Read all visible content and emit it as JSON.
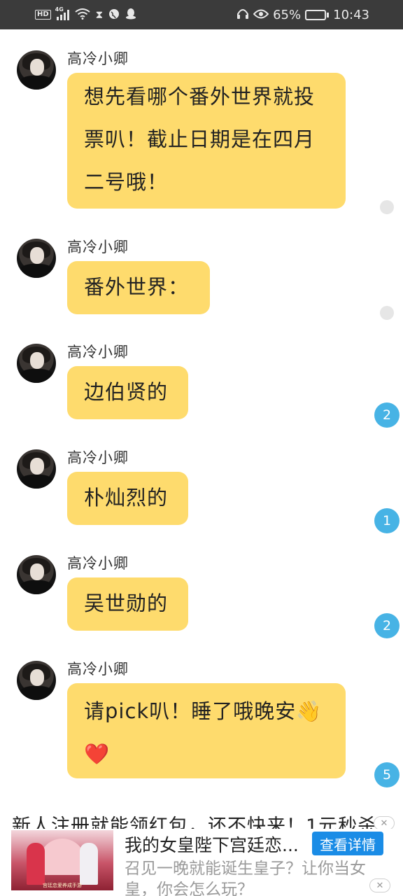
{
  "status_bar": {
    "hd": "HD",
    "network": "4G",
    "battery_pct": "65%",
    "time": "10:43",
    "battery_level": 0.65
  },
  "messages": [
    {
      "sender": "高冷小卿",
      "lines": [
        "想先看哪个番外世界就投",
        "票叭！截止日期是在四月",
        "二号哦！"
      ],
      "emoji": "",
      "badge": "",
      "read_dot": true
    },
    {
      "sender": "高冷小卿",
      "lines": [
        "番外世界："
      ],
      "emoji": "",
      "badge": "",
      "read_dot": true
    },
    {
      "sender": "高冷小卿",
      "lines": [
        "边伯贤的"
      ],
      "emoji": "",
      "badge": "2",
      "read_dot": false
    },
    {
      "sender": "高冷小卿",
      "lines": [
        "朴灿烈的"
      ],
      "emoji": "",
      "badge": "1",
      "read_dot": false
    },
    {
      "sender": "高冷小卿",
      "lines": [
        "吴世勋的"
      ],
      "emoji": "",
      "badge": "2",
      "read_dot": false
    },
    {
      "sender": "高冷小卿",
      "lines": [
        "请pick叭！睡了哦晚安👋",
        "❤️"
      ],
      "emoji": "",
      "badge": "5",
      "read_dot": false
    }
  ],
  "ad": {
    "cut_text": "新人注册就能领红包，还不快来！1元秒杀",
    "title": "我的女皇陛下宫廷恋...",
    "cta": "查看详情",
    "description": "召见一晚就能诞生皇子？让你当女皇，你会怎么玩？",
    "thumb_caption": "宫廷恋爱养成手游",
    "close_icon": "close-icon"
  },
  "colors": {
    "bubble": "#fedb6d",
    "badge": "#47b3e5",
    "status_bar": "#3b3b3b",
    "cta": "#1a8ce6"
  }
}
